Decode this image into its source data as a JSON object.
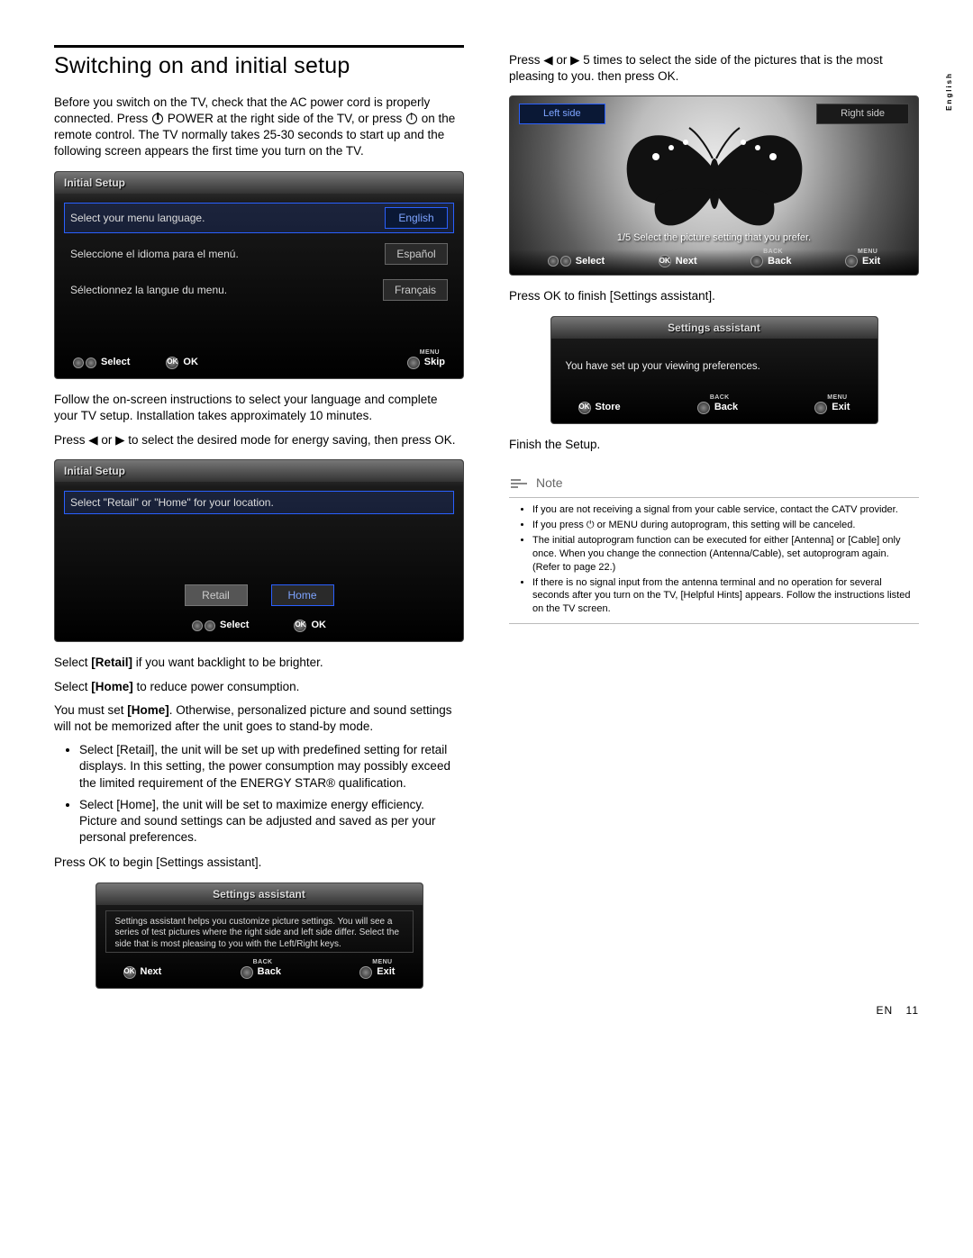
{
  "language_tab": "English",
  "title": "Switching on and initial setup",
  "p1_a": "Before you switch on the TV, check that the AC power cord is properly connected. Press ",
  "p1_b": " POWER at the right side of the TV, or press ",
  "p1_c": " on the remote control. The TV normally takes 25-30 seconds to start up and the following screen appears the first time you turn on the TV.",
  "panel1": {
    "title": "Initial Setup",
    "rows": [
      {
        "text": "Select your menu language.",
        "opt": "English",
        "selected": true
      },
      {
        "text": "Seleccione el idioma para el menú.",
        "opt": "Español",
        "selected": false
      },
      {
        "text": "Sélectionnez la langue du menu.",
        "opt": "Français",
        "selected": false
      }
    ],
    "actions": [
      {
        "label": "Select",
        "icon": "ring-dbl"
      },
      {
        "label": "OK",
        "icon": "ok"
      },
      {
        "label": "Skip",
        "icon": "menu",
        "sup": "MENU"
      }
    ]
  },
  "p2": "Follow the on-screen instructions to select your language and complete your TV setup. Installation takes approximately 10 minutes.",
  "p3": "Press ◀ or ▶ to select the desired mode for energy saving, then press OK.",
  "panel2": {
    "title": "Initial Setup",
    "prompt": "Select \"Retail\" or \"Home\" for your location.",
    "options": [
      "Retail",
      "Home"
    ],
    "actions": [
      {
        "label": "Select",
        "icon": "ring-dbl"
      },
      {
        "label": "OK",
        "icon": "ok"
      }
    ]
  },
  "p4_a": "Select ",
  "p4_b": " if you want backlight to be brighter.",
  "p4_retail": "[Retail]",
  "p5_a": "Select ",
  "p5_b": " to reduce power consumption.",
  "p5_home": "[Home]",
  "p6_a": "You must set ",
  "p6_b": ". Otherwise, personalized picture and sound settings will not be memorized after the unit goes to stand-by mode.",
  "bullets_left": [
    "Select [Retail], the unit will be set up with predefined setting for retail displays. In this setting, the power consumption may possibly exceed the limited requirement of the ENERGY STAR® qualification.",
    "Select [Home], the unit will be set to maximize energy efficiency. Picture and sound settings can be adjusted and saved as per your personal preferences."
  ],
  "p7": "Press OK to begin [Settings assistant].",
  "panel3": {
    "title": "Settings assistant",
    "msg": "Settings assistant helps you customize picture settings. You will see a series of test pictures where the right side and left side differ. Select the side that is most pleasing to you with the Left/Right keys.",
    "actions": [
      {
        "label": "Next",
        "icon": "ok"
      },
      {
        "label": "Back",
        "icon": "back",
        "sup": "BACK"
      },
      {
        "label": "Exit",
        "icon": "menu",
        "sup": "MENU"
      }
    ]
  },
  "p_r1": "Press ◀ or ▶ 5 times to select the side of the pictures that is the most pleasing to you. then press OK.",
  "picpanel": {
    "left": "Left side",
    "right": "Right side",
    "caption": "1/5 Select the picture setting that you prefer.",
    "actions": [
      {
        "label": "Select",
        "icon": "ring-dbl"
      },
      {
        "label": "Next",
        "icon": "ok"
      },
      {
        "label": "Back",
        "icon": "back",
        "sup": "BACK"
      },
      {
        "label": "Exit",
        "icon": "menu",
        "sup": "MENU"
      }
    ]
  },
  "p_r2": "Press OK to finish [Settings assistant].",
  "panel4": {
    "title": "Settings assistant",
    "msg": "You have set up your viewing preferences.",
    "actions": [
      {
        "label": "Store",
        "icon": "ok"
      },
      {
        "label": "Back",
        "icon": "back",
        "sup": "BACK"
      },
      {
        "label": "Exit",
        "icon": "menu",
        "sup": "MENU"
      }
    ]
  },
  "p_r3": "Finish the Setup.",
  "note_label": "Note",
  "notes": [
    "If you are not receiving a signal from your cable service, contact the CATV provider.",
    "If you press ⏻ or MENU during autoprogram, this setting will be canceled.",
    "The initial autoprogram function can be executed for either [Antenna] or [Cable] only once. When you change the connection (Antenna/Cable), set autoprogram again. (Refer to page 22.)",
    "If there is no signal input from the antenna terminal and no operation for several seconds after you turn on the TV, [Helpful Hints] appears. Follow the instructions listed on the TV screen."
  ],
  "footer_lang": "EN",
  "footer_page": "11"
}
